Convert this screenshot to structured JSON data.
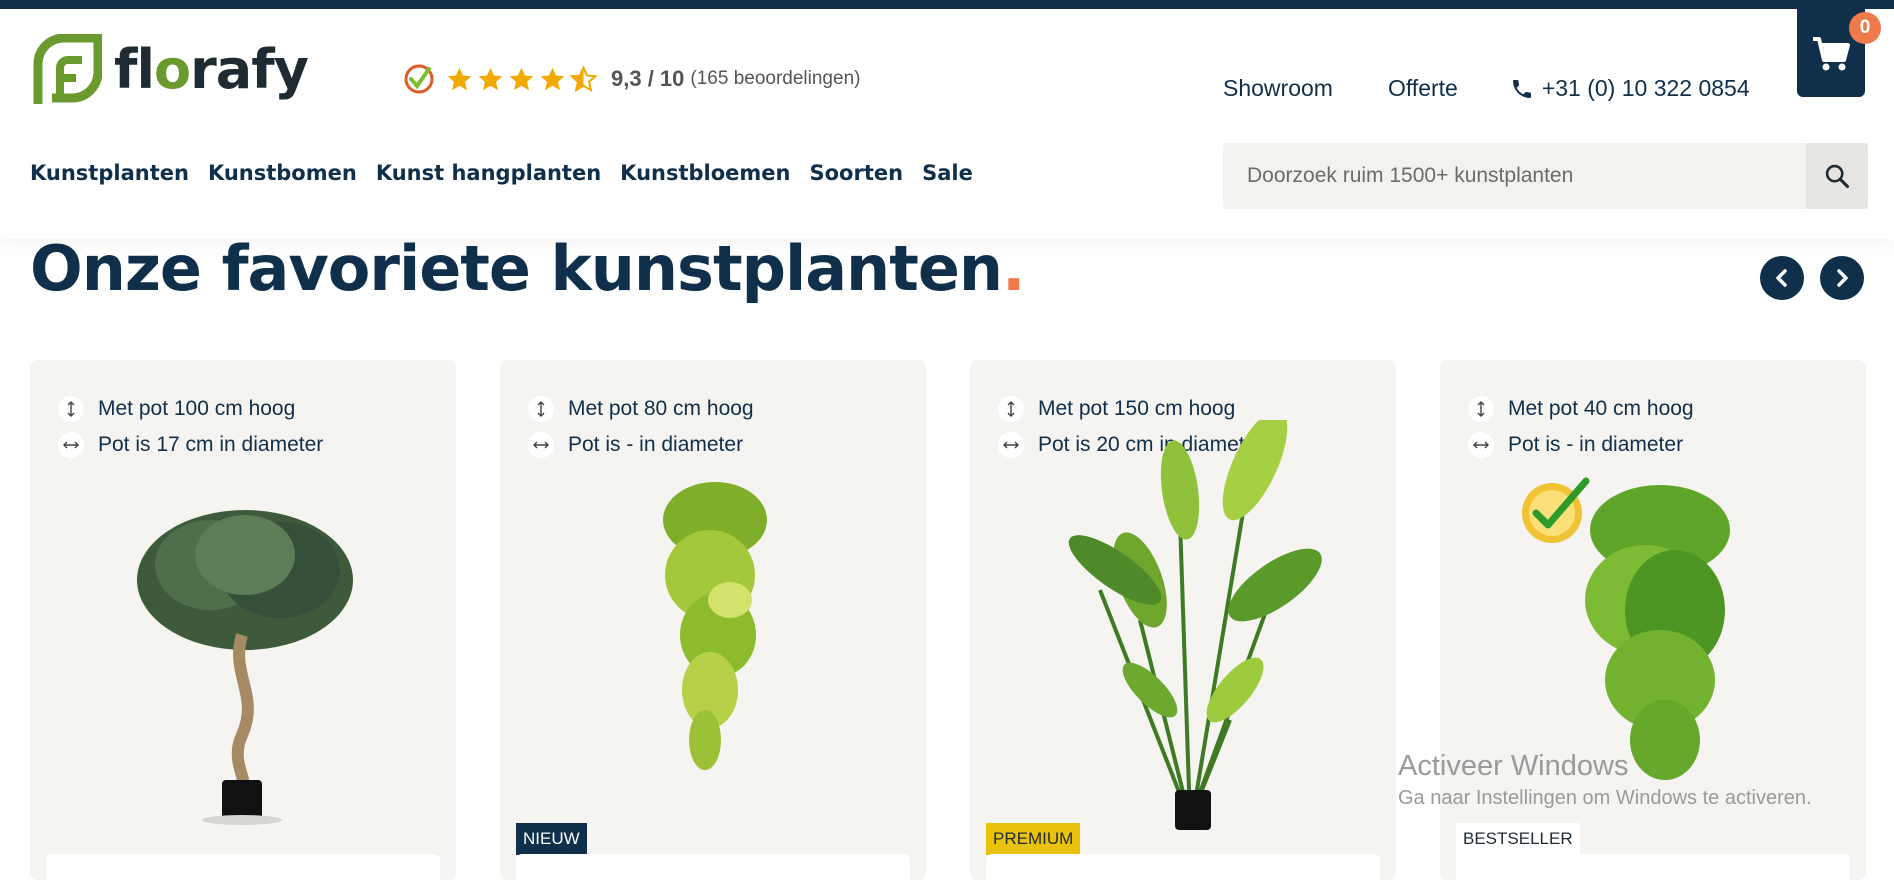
{
  "header": {
    "logo_text_pre": "fl",
    "logo_text_o": "o",
    "logo_text_post": "rafy",
    "rating": {
      "score": "9,3 / 10",
      "reviews": "(165 beoordelingen)",
      "stars_value": 4.5,
      "stars_max": 5
    },
    "links": {
      "showroom": "Showroom",
      "offerte": "Offerte",
      "phone": "+31 (0) 10 322 0854"
    },
    "cart_count": "0",
    "nav": [
      "Kunstplanten",
      "Kunstbomen",
      "Kunst hangplanten",
      "Kunstbloemen",
      "Soorten",
      "Sale"
    ],
    "search": {
      "placeholder": "Doorzoek ruim 1500+ kunstplanten"
    }
  },
  "section": {
    "title": "Onze favoriete kunstplanten",
    "title_dot": "."
  },
  "products": [
    {
      "height": "Met pot 100 cm hoog",
      "diameter": "Pot is 17 cm in diameter",
      "badge": ""
    },
    {
      "height": "Met pot 80 cm hoog",
      "diameter": "Pot is - in diameter",
      "badge": "NIEUW"
    },
    {
      "height": "Met pot 150 cm hoog",
      "diameter": "Pot is 20 cm in diameter",
      "badge": "PREMIUM"
    },
    {
      "height": "Met pot 40 cm hoog",
      "diameter": "Pot is - in diameter",
      "badge": "BESTSELLER"
    }
  ],
  "colors": {
    "navy": "#0f2f4b",
    "accent": "#ef7a4b",
    "brand_green": "#6a9a2e",
    "badge_new": "#0f2f4b",
    "badge_premium": "#e8c20c",
    "badge_bestseller": "#ffffff"
  },
  "watermark": {
    "line1": "Activeer Windows",
    "line2": "Ga naar Instellingen om Windows te activeren."
  }
}
